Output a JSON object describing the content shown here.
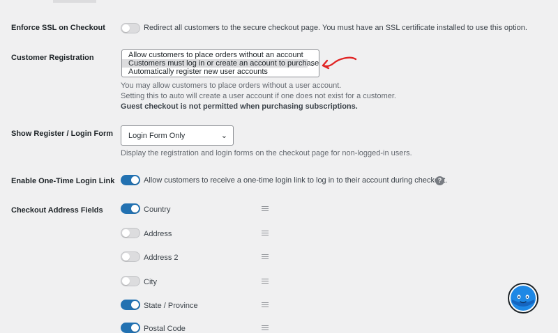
{
  "ssl": {
    "label": "Enforce SSL on Checkout",
    "enabled": false,
    "description": "Redirect all customers to the secure checkout page. You must have an SSL certificate installed to use this option."
  },
  "registration": {
    "label": "Customer Registration",
    "options": [
      "Allow customers to place orders without an account",
      "Customers must log in or create an account to purchase",
      "Automatically register new user accounts"
    ],
    "selected_index": 1,
    "help_1": "You may allow customers to place orders without a user account.",
    "help_2": "Setting this to auto will create a user account if one does not exist for a customer.",
    "help_3": "Guest checkout is not permitted when purchasing subscriptions.",
    "annotation_color": "#e02424"
  },
  "login_form": {
    "label": "Show Register / Login Form",
    "value": "Login Form Only",
    "help": "Display the registration and login forms on the checkout page for non-logged-in users."
  },
  "one_time_login": {
    "label": "Enable One-Time Login Link",
    "enabled": true,
    "description": "Allow customers to receive a one-time login link to log in to their account during checkout.",
    "help_icon": "?"
  },
  "address_fields": {
    "label": "Checkout Address Fields",
    "fields": [
      {
        "name": "Country",
        "enabled": true
      },
      {
        "name": "Address",
        "enabled": false
      },
      {
        "name": "Address 2",
        "enabled": false
      },
      {
        "name": "City",
        "enabled": false
      },
      {
        "name": "State / Province",
        "enabled": true
      },
      {
        "name": "Postal Code",
        "enabled": true
      }
    ]
  },
  "colors": {
    "accent": "#2271b1",
    "toggle_off": "#dcdcde",
    "background": "#f0f0f1",
    "mascot": "#1e88e5"
  }
}
